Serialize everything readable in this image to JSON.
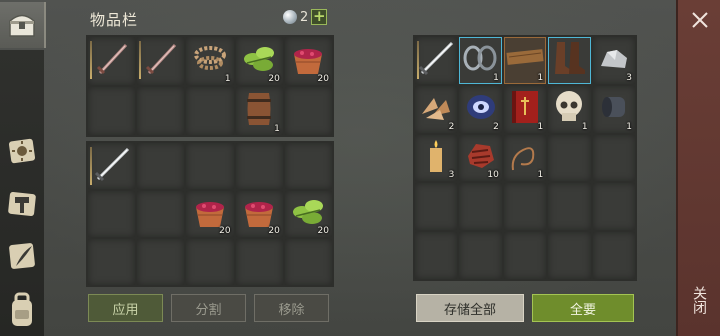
{
  "panel": {
    "title": "物品栏",
    "gem_count": "2",
    "plus": "+"
  },
  "left_rail": {
    "tabs": [
      "chest-icon",
      "sun-scroll-icon",
      "hammer-scroll-icon",
      "quill-scroll-icon",
      "backpack-icon"
    ]
  },
  "inventory_top": {
    "cells": [
      {
        "icon": "sword",
        "qty": "",
        "durab": true
      },
      {
        "icon": "sword",
        "qty": "",
        "durab": true
      },
      {
        "icon": "rope",
        "qty": "1"
      },
      {
        "icon": "herbs",
        "qty": "20"
      },
      {
        "icon": "berry-bowl",
        "qty": "20"
      },
      {
        "icon": "",
        "qty": ""
      },
      {
        "icon": "",
        "qty": ""
      },
      {
        "icon": "",
        "qty": ""
      },
      {
        "icon": "barrel",
        "qty": "1"
      },
      {
        "icon": "",
        "qty": ""
      }
    ]
  },
  "inventory_bottom": {
    "cells": [
      {
        "icon": "sword-light",
        "qty": "",
        "durab": true
      },
      {
        "icon": "",
        "qty": ""
      },
      {
        "icon": "",
        "qty": ""
      },
      {
        "icon": "",
        "qty": ""
      },
      {
        "icon": "",
        "qty": ""
      },
      {
        "icon": "",
        "qty": ""
      },
      {
        "icon": "",
        "qty": ""
      },
      {
        "icon": "berry-bowl",
        "qty": "20"
      },
      {
        "icon": "berry-bowl",
        "qty": "20"
      },
      {
        "icon": "herbs",
        "qty": "20"
      },
      {
        "icon": "",
        "qty": ""
      },
      {
        "icon": "",
        "qty": ""
      },
      {
        "icon": "",
        "qty": ""
      },
      {
        "icon": "",
        "qty": ""
      },
      {
        "icon": "",
        "qty": ""
      }
    ]
  },
  "storage": {
    "cells": [
      {
        "icon": "sword-light",
        "qty": "",
        "durab": true
      },
      {
        "icon": "chain",
        "qty": "1",
        "style": "blue"
      },
      {
        "icon": "plank",
        "qty": "1",
        "style": "brown"
      },
      {
        "icon": "boots",
        "qty": "",
        "style": "blue"
      },
      {
        "icon": "ore",
        "qty": "3"
      },
      {
        "icon": "flakes",
        "qty": "2"
      },
      {
        "icon": "eye-gem",
        "qty": "2"
      },
      {
        "icon": "book",
        "qty": "1"
      },
      {
        "icon": "skull",
        "qty": "1"
      },
      {
        "icon": "pipe",
        "qty": "1"
      },
      {
        "icon": "candle",
        "qty": "3"
      },
      {
        "icon": "meat",
        "qty": "10"
      },
      {
        "icon": "whip",
        "qty": "1"
      },
      {
        "icon": "",
        "qty": ""
      },
      {
        "icon": "",
        "qty": ""
      },
      {
        "icon": "",
        "qty": ""
      },
      {
        "icon": "",
        "qty": ""
      },
      {
        "icon": "",
        "qty": ""
      },
      {
        "icon": "",
        "qty": ""
      },
      {
        "icon": "",
        "qty": ""
      },
      {
        "icon": "",
        "qty": ""
      },
      {
        "icon": "",
        "qty": ""
      },
      {
        "icon": "",
        "qty": ""
      },
      {
        "icon": "",
        "qty": ""
      },
      {
        "icon": "",
        "qty": ""
      }
    ]
  },
  "buttons": {
    "apply": "应用",
    "split": "分割",
    "remove": "移除",
    "store_all": "存储全部",
    "take_all": "全要"
  },
  "close": {
    "label": "关闭"
  }
}
